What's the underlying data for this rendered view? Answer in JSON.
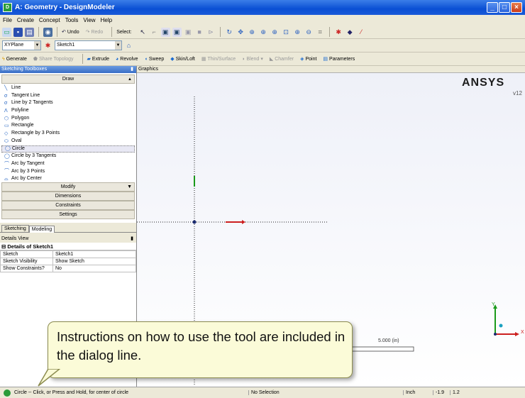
{
  "window": {
    "title": "A: Geometry - DesignModeler"
  },
  "menu": [
    "File",
    "Create",
    "Concept",
    "Tools",
    "View",
    "Help"
  ],
  "toolbar1": {
    "undo_label": "Undo",
    "redo_label": "Redo",
    "select_label": "Select:"
  },
  "toolbar2": {
    "plane": "XYPlane",
    "sketch": "Sketch1"
  },
  "toolbar3": {
    "buttons": [
      {
        "label": "Generate",
        "disabled": false
      },
      {
        "label": "Share Topology",
        "disabled": true
      },
      {
        "label": "Extrude",
        "disabled": false
      },
      {
        "label": "Revolve",
        "disabled": false
      },
      {
        "label": "Sweep",
        "disabled": false
      },
      {
        "label": "Skin/Loft",
        "disabled": false
      },
      {
        "label": "Thin/Surface",
        "disabled": true
      },
      {
        "label": "Blend",
        "disabled": true
      },
      {
        "label": "Chamfer",
        "disabled": true
      },
      {
        "label": "Point",
        "disabled": false
      },
      {
        "label": "Parameters",
        "disabled": false
      }
    ]
  },
  "sketching_toolboxes": {
    "title": "Sketching Toolboxes",
    "draw_header": "Draw",
    "draw_items": [
      {
        "label": "Line",
        "icon": "line-icon"
      },
      {
        "label": "Tangent Line",
        "icon": "tangent-line-icon"
      },
      {
        "label": "Line by 2 Tangents",
        "icon": "line-2-tangents-icon"
      },
      {
        "label": "Polyline",
        "icon": "polyline-icon"
      },
      {
        "label": "Polygon",
        "icon": "polygon-icon"
      },
      {
        "label": "Rectangle",
        "icon": "rectangle-icon"
      },
      {
        "label": "Rectangle by 3 Points",
        "icon": "rectangle-3pt-icon"
      },
      {
        "label": "Oval",
        "icon": "oval-icon"
      },
      {
        "label": "Circle",
        "icon": "circle-icon"
      },
      {
        "label": "Circle by 3 Tangents",
        "icon": "circle-3-tangents-icon"
      },
      {
        "label": "Arc by Tangent",
        "icon": "arc-tangent-icon"
      },
      {
        "label": "Arc by 3 Points",
        "icon": "arc-3pt-icon"
      },
      {
        "label": "Arc by Center",
        "icon": "arc-center-icon"
      }
    ],
    "selected_item": "Circle",
    "groups": [
      "Modify",
      "Dimensions",
      "Constraints",
      "Settings"
    ],
    "tabs": [
      "Sketching",
      "Modeling"
    ],
    "active_tab": "Modeling"
  },
  "details_view": {
    "title": "Details View",
    "section": "Details of Sketch1",
    "rows": [
      {
        "key": "Sketch",
        "value": "Sketch1"
      },
      {
        "key": "Sketch Visibility",
        "value": "Show Sketch"
      },
      {
        "key": "Show Constraints?",
        "value": "No"
      }
    ]
  },
  "graphics": {
    "title": "Graphics",
    "brand_logo_text": "ANSYS",
    "brand_version": "v12",
    "scale_label": "5.000 (in)",
    "triad_y": "Y",
    "triad_x": "X"
  },
  "callout": {
    "text": "Instructions on how to use the tool are included in the dialog line."
  },
  "statusbar": {
    "message": "Circle -- Click, or Press and Hold, for center of circle",
    "selection": "No Selection",
    "units": "Inch",
    "coord_x": "-1.9",
    "coord_y": "1.2"
  },
  "colors": {
    "title_bar": "#0a4fd4",
    "panel_header": "#3a6ec6",
    "axis_red": "#cc2020",
    "axis_green": "#1a9a1a",
    "callout_bg": "#fbfbd8"
  }
}
